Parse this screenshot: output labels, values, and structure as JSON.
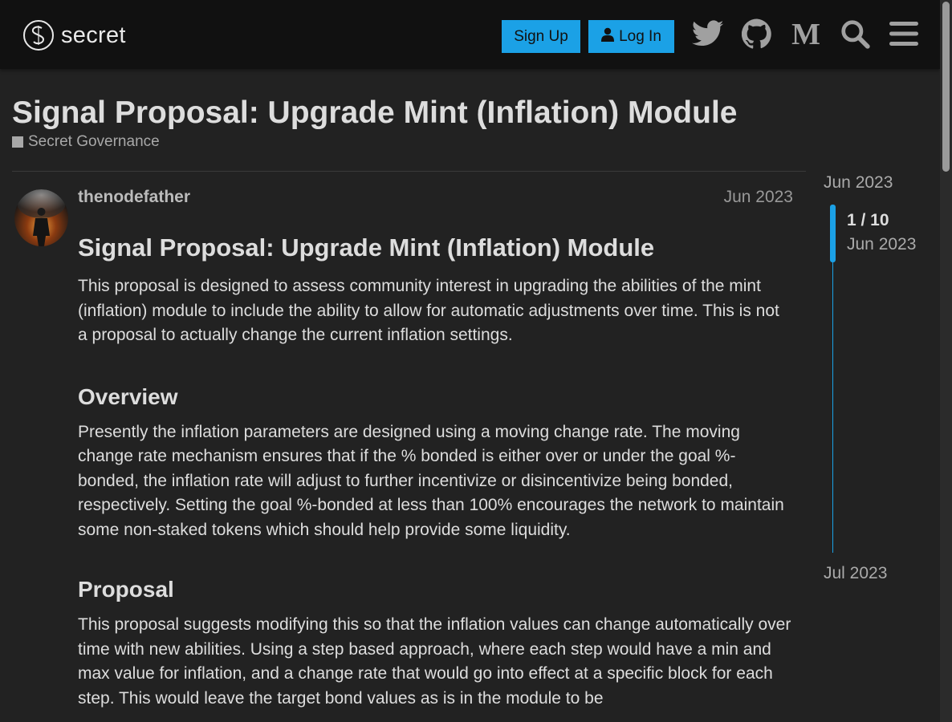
{
  "header": {
    "logo_text": "secret",
    "signup_label": "Sign Up",
    "login_label": "Log In",
    "icons": [
      "twitter-icon",
      "github-icon",
      "medium-icon",
      "search-icon",
      "menu-icon"
    ]
  },
  "topic": {
    "title": "Signal Proposal: Upgrade Mint (Inflation) Module",
    "category": "Secret Governance"
  },
  "post": {
    "username": "thenodefather",
    "date": "Jun 2023",
    "heading": "Signal Proposal: Upgrade Mint (Inflation) Module",
    "intro": "This proposal is designed to assess community interest in upgrading the abilities of the mint (inflation) module to include the ability to allow for automatic adjustments over time. This is not a proposal to actually change the current inflation settings.",
    "overview_heading": "Overview",
    "overview_text": "Presently the inflation parameters are designed using a moving change rate. The moving change rate mechanism ensures that if the % bonded is either over or under the goal %-bonded, the inflation rate will adjust to further incentivize or disincentivize being bonded, respectively. Setting the goal %-bonded at less than 100% encourages the network to maintain some non-staked tokens which should help provide some liquidity.",
    "proposal_heading": "Proposal",
    "proposal_text": "This proposal suggests modifying this so that the inflation values can change automatically over time with new abilities. Using a step based approach, where each step would have a min and max value for inflation, and a change rate that would go into effect at a specific block for each step. This would leave the target bond values as is in the module to be"
  },
  "timeline": {
    "start_date": "Jun 2023",
    "position": "1 / 10",
    "current_date": "Jun 2023",
    "end_date": "Jul 2023"
  },
  "colors": {
    "accent": "#1ba1e6",
    "background": "#222222",
    "header_bg": "#111111"
  }
}
